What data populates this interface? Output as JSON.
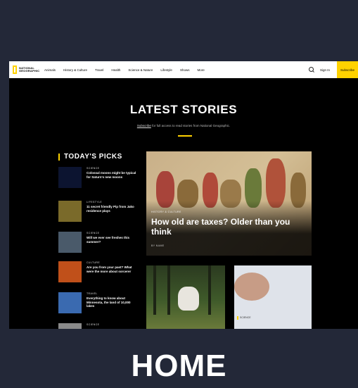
{
  "nav": {
    "logo_text": "NATIONAL GEOGRAPHIC",
    "links": [
      "Animals",
      "History & Culture",
      "Travel",
      "Health",
      "Science & Nature",
      "Lifestyle",
      "Shows",
      "More"
    ],
    "signin": "Sign In",
    "subscribe": "Subscribe"
  },
  "main": {
    "heading": "LATEST STORIES",
    "promo_link": "Subscribe",
    "promo_text": " for full access to read stories from National Geographic.",
    "picks_title": "TODAY'S PICKS",
    "picks": [
      {
        "tag": "SCIENCE",
        "title": "Colossal moons might be typical for Saturn's new moons",
        "thumb": "#0c1430"
      },
      {
        "tag": "LIFESTYLE",
        "title": "11 secret friendly Pip from Jako residence plays",
        "thumb": "#7a6a2a"
      },
      {
        "tag": "SCIENCE",
        "title": "Will we ever see freshes this summer?",
        "thumb": "#4a5a6a"
      },
      {
        "tag": "CULTURE",
        "title": "Are you from your past? What were the more about sorcerer",
        "thumb": "#c0501a"
      },
      {
        "tag": "TRAVEL",
        "title": "Everything to know about Minnesota, the land of 10,000 lakes",
        "thumb": "#3a6ab0"
      },
      {
        "tag": "SCIENCE",
        "title": "",
        "thumb": "#8a8a8a"
      }
    ],
    "hero": {
      "tag": "HISTORY & CULTURE",
      "title": "How old are taxes? Older than you think",
      "byline": "BY NAME"
    },
    "card_hand_tag": "SCIENCE"
  },
  "caption": "HOME"
}
